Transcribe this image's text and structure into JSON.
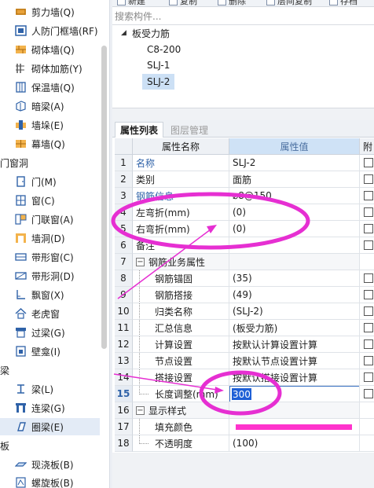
{
  "left_nav": {
    "groups": [
      {
        "label": "门窗洞",
        "items": []
      },
      {
        "label": "梁",
        "items": []
      },
      {
        "label": "板",
        "items": []
      }
    ],
    "items_wall": [
      {
        "label": "剪力墙(Q)",
        "icon": "shear-wall-icon"
      },
      {
        "label": "人防门框墙(RF)",
        "icon": "civil-defense-door-frame-wall-icon"
      },
      {
        "label": "砌体墙(Q)",
        "icon": "masonry-wall-icon"
      },
      {
        "label": "砌体加筋(Y)",
        "icon": "masonry-reinforcement-icon"
      },
      {
        "label": "保温墙(Q)",
        "icon": "insulation-wall-icon"
      },
      {
        "label": "暗梁(A)",
        "icon": "hidden-beam-icon"
      },
      {
        "label": "墙垛(E)",
        "icon": "wall-pier-icon"
      },
      {
        "label": "幕墙(Q)",
        "icon": "curtain-wall-icon"
      }
    ],
    "items_door": [
      {
        "label": "门(M)",
        "icon": "door-icon"
      },
      {
        "label": "窗(C)",
        "icon": "window-icon"
      },
      {
        "label": "门联窗(A)",
        "icon": "door-window-combo-icon"
      },
      {
        "label": "墙洞(D)",
        "icon": "wall-opening-icon"
      },
      {
        "label": "带形窗(C)",
        "icon": "strip-window-icon"
      },
      {
        "label": "带形洞(D)",
        "icon": "strip-opening-icon"
      },
      {
        "label": "飘窗(X)",
        "icon": "bay-window-icon"
      },
      {
        "label": "老虎窗",
        "icon": "dormer-window-icon"
      },
      {
        "label": "过梁(G)",
        "icon": "lintel-icon"
      },
      {
        "label": "壁龛(I)",
        "icon": "niche-icon"
      }
    ],
    "items_beam": [
      {
        "label": "梁(L)",
        "icon": "beam-icon"
      },
      {
        "label": "连梁(G)",
        "icon": "coupling-beam-icon"
      },
      {
        "label": "圈梁(E)",
        "icon": "ring-beam-icon",
        "selected": true
      }
    ],
    "items_slab": [
      {
        "label": "现浇板(B)",
        "icon": "cast-slab-icon"
      },
      {
        "label": "螺旋板(B)",
        "icon": "spiral-slab-icon"
      }
    ]
  },
  "toolbar": {
    "buttons": [
      "新建",
      "复制",
      "删除",
      "层间复制",
      "存档"
    ]
  },
  "search": {
    "placeholder": "搜索构件..."
  },
  "component_tree": {
    "root": "板受力筋",
    "children": [
      "C8-200",
      "SLJ-1",
      "SLJ-2"
    ],
    "selected": "SLJ-2"
  },
  "tabs": {
    "property_list": "属性列表",
    "layer_management": "图层管理"
  },
  "grid": {
    "headers": {
      "name": "属性名称",
      "value": "属性值",
      "attach": "附"
    },
    "rows": [
      {
        "num": "1",
        "name": "名称",
        "value": "SLJ-2"
      },
      {
        "num": "2",
        "name": "类别",
        "value": "面筋"
      },
      {
        "num": "3",
        "name": "钢筋信息",
        "value": "⌀8@150"
      },
      {
        "num": "4",
        "name": "左弯折(mm)",
        "value": "(0)"
      },
      {
        "num": "5",
        "name": "右弯折(mm)",
        "value": "(0)"
      },
      {
        "num": "6",
        "name": "备注",
        "value": ""
      },
      {
        "num": "7",
        "name": "钢筋业务属性",
        "value": ""
      },
      {
        "num": "8",
        "name": "钢筋锚固",
        "value": "(35)"
      },
      {
        "num": "9",
        "name": "钢筋搭接",
        "value": "(49)"
      },
      {
        "num": "10",
        "name": "归类名称",
        "value": "(SLJ-2)"
      },
      {
        "num": "11",
        "name": "汇总信息",
        "value": "(板受力筋)"
      },
      {
        "num": "12",
        "name": "计算设置",
        "value": "按默认计算设置计算"
      },
      {
        "num": "13",
        "name": "节点设置",
        "value": "按默认节点设置计算"
      },
      {
        "num": "14",
        "name": "搭接设置",
        "value": "按默认搭接设置计算"
      },
      {
        "num": "15",
        "name": "长度调整(mm)",
        "value": "300"
      },
      {
        "num": "16",
        "name": "显示样式",
        "value": ""
      },
      {
        "num": "17",
        "name": "填充颜色",
        "value": ""
      },
      {
        "num": "18",
        "name": "不透明度",
        "value": "(100)"
      }
    ]
  },
  "colors": {
    "annotation": "#e62fd2",
    "fill_color_swatch": "#ff33cc",
    "selection": "#1e5fd6"
  }
}
